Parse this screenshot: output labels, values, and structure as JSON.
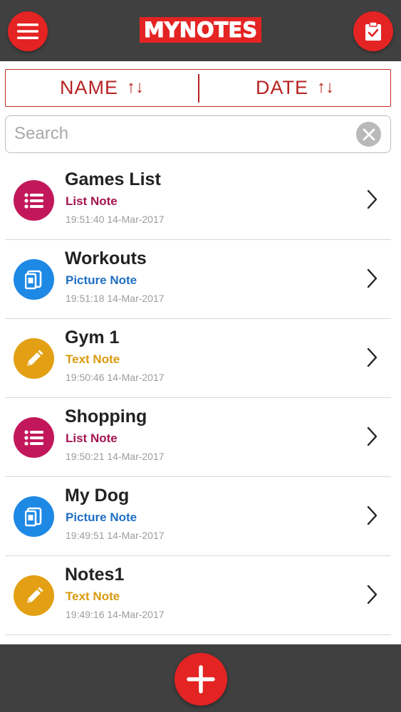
{
  "header": {
    "brand": "MYNOTES",
    "menu_icon": "hamburger-menu-icon",
    "clipboard_icon": "clipboard-check-icon",
    "accent_color": "#e42323",
    "bar_color": "#404040"
  },
  "sort": {
    "name_label": "NAME",
    "date_label": "DATE",
    "arrows": "↑↓"
  },
  "search": {
    "placeholder": "Search",
    "value": "",
    "clear_icon": "close-icon"
  },
  "notes": [
    {
      "title": "Games List",
      "type": "List Note",
      "timestamp": "19:51:40 14-Mar-2017",
      "kind": "list",
      "color": "#c2185b",
      "icon": "list-icon"
    },
    {
      "title": "Workouts",
      "type": "Picture Note",
      "timestamp": "19:51:18 14-Mar-2017",
      "kind": "picture",
      "color": "#1e88e5",
      "icon": "picture-icon"
    },
    {
      "title": "Gym 1",
      "type": "Text Note",
      "timestamp": "19:50:46 14-Mar-2017",
      "kind": "text",
      "color": "#e3a014",
      "icon": "pencil-icon"
    },
    {
      "title": "Shopping",
      "type": "List Note",
      "timestamp": "19:50:21 14-Mar-2017",
      "kind": "list",
      "color": "#c2185b",
      "icon": "list-icon"
    },
    {
      "title": "My Dog",
      "type": "Picture Note",
      "timestamp": "19:49:51 14-Mar-2017",
      "kind": "picture",
      "color": "#1e88e5",
      "icon": "picture-icon"
    },
    {
      "title": "Notes1",
      "type": "Text Note",
      "timestamp": "19:49:16 14-Mar-2017",
      "kind": "text",
      "color": "#e3a014",
      "icon": "pencil-icon"
    }
  ],
  "footer": {
    "add_icon": "plus-icon"
  }
}
